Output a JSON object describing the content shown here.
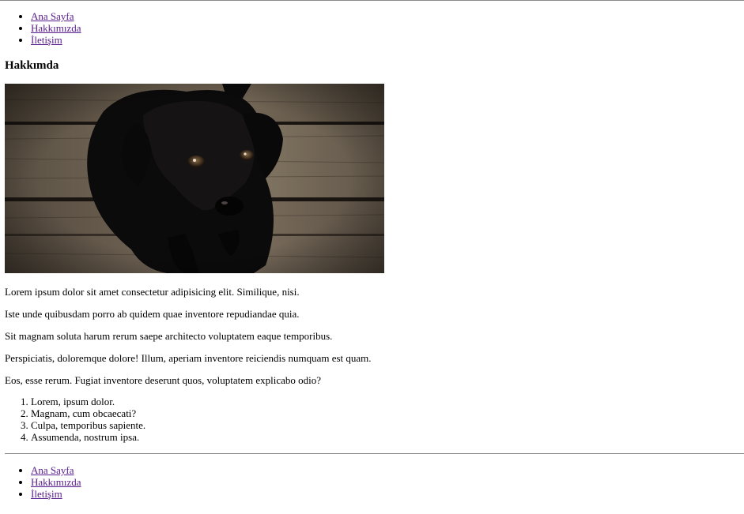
{
  "header": {
    "nav": [
      {
        "label": "Ana Sayfa"
      },
      {
        "label": "Hakkımızda"
      },
      {
        "label": "İletişim"
      }
    ]
  },
  "main": {
    "title": "Hakkımda",
    "image": {
      "subject": "black puppy on wooden floor"
    },
    "paragraphs": [
      "Lorem ipsum dolor sit amet consectetur adipisicing elit. Similique, nisi.",
      "Iste unde quibusdam porro ab quidem quae inventore repudiandae quia.",
      "Sit magnam soluta harum rerum saepe architecto voluptatem eaque temporibus.",
      "Perspiciatis, doloremque dolore! Illum, aperiam inventore reiciendis numquam est quam.",
      "Eos, esse rerum. Fugiat inventore deserunt quos, voluptatem explicabo odio?"
    ],
    "ordered_list": [
      "Lorem, ipsum dolor.",
      "Magnam, cum obcaecati?",
      "Culpa, temporibus sapiente.",
      "Assumenda, nostrum ipsa."
    ]
  },
  "footer": {
    "nav": [
      {
        "label": "Ana Sayfa"
      },
      {
        "label": "Hakkımızda"
      },
      {
        "label": "İletişim"
      }
    ]
  },
  "colors": {
    "visited_link": "#551a8b",
    "rule": "#8a8a8a"
  }
}
